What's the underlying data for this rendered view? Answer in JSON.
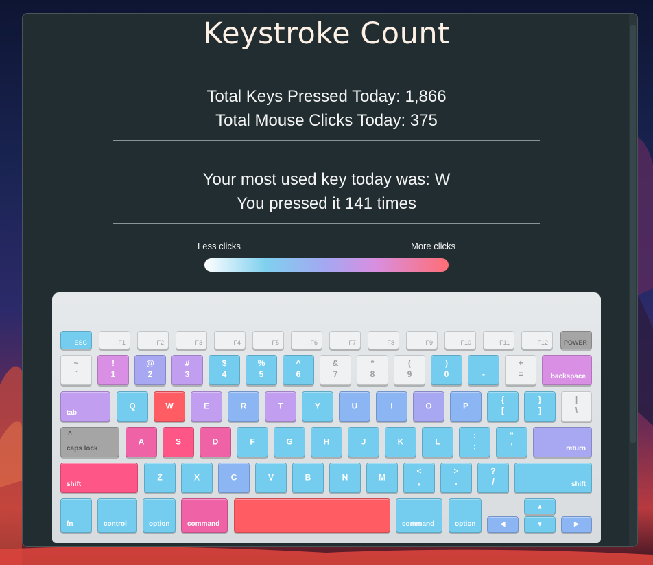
{
  "app": {
    "title": "Keystroke Count",
    "stats": {
      "keys_line": "Total Keys Pressed Today: 1,866",
      "clicks_line": "Total Mouse Clicks Today: 375",
      "most_used_line": "Your most used key today was: W",
      "pressed_line": "You pressed it 141 times"
    },
    "legend": {
      "less": "Less clicks",
      "more": "More clicks",
      "colors": [
        "#ffffff",
        "#7fd0ef",
        "#a5a7f1",
        "#d88fe0",
        "#ff6e76"
      ]
    }
  },
  "keyboard": {
    "fn_row": {
      "esc": "ESC",
      "f1": "F1",
      "f2": "F2",
      "f3": "F3",
      "f4": "F4",
      "f5": "F5",
      "f6": "F6",
      "f7": "F7",
      "f8": "F8",
      "f9": "F9",
      "f10": "F10",
      "f11": "F11",
      "f12": "F12",
      "power": "POWER"
    },
    "number_row": {
      "tilde": [
        "~",
        "`"
      ],
      "k1": [
        "!",
        "1"
      ],
      "k2": [
        "@",
        "2"
      ],
      "k3": [
        "#",
        "3"
      ],
      "k4": [
        "$",
        "4"
      ],
      "k5": [
        "%",
        "5"
      ],
      "k6": [
        "^",
        "6"
      ],
      "k7": [
        "&",
        "7"
      ],
      "k8": [
        "*",
        "8"
      ],
      "k9": [
        "(",
        "9"
      ],
      "k0": [
        ")",
        "0"
      ],
      "minus": [
        "_",
        "-"
      ],
      "equals": [
        "+",
        "="
      ],
      "backspace": "backspace"
    },
    "top_row": {
      "tab": "tab",
      "q": "Q",
      "w": "W",
      "e": "E",
      "r": "R",
      "t": "T",
      "y": "Y",
      "u": "U",
      "i": "I",
      "o": "O",
      "p": "P",
      "lbracket": [
        "{",
        "["
      ],
      "rbracket": [
        "}",
        "]"
      ],
      "backslash": [
        "|",
        "\\"
      ]
    },
    "home_row": {
      "caps_top": "^",
      "caps": "caps lock",
      "a": "A",
      "s": "S",
      "d": "D",
      "f": "F",
      "g": "G",
      "h": "H",
      "j": "J",
      "k": "K",
      "l": "L",
      "semicolon": [
        ":",
        ";"
      ],
      "quote": [
        "\"",
        "'"
      ],
      "return": "return"
    },
    "bottom_row": {
      "lshift": "shift",
      "z": "Z",
      "x": "X",
      "c": "C",
      "v": "V",
      "b": "B",
      "n": "N",
      "m": "M",
      "comma": [
        "<",
        ","
      ],
      "period": [
        ">",
        "."
      ],
      "slash": [
        "?",
        "/"
      ],
      "rshift": "shift"
    },
    "mod_row": {
      "fn": "fn",
      "control": "control",
      "loption": "option",
      "lcommand": "command",
      "rcommand": "command",
      "roption": "option",
      "up": "▲",
      "left": "◀",
      "down": "▼",
      "right": "▶"
    }
  }
}
